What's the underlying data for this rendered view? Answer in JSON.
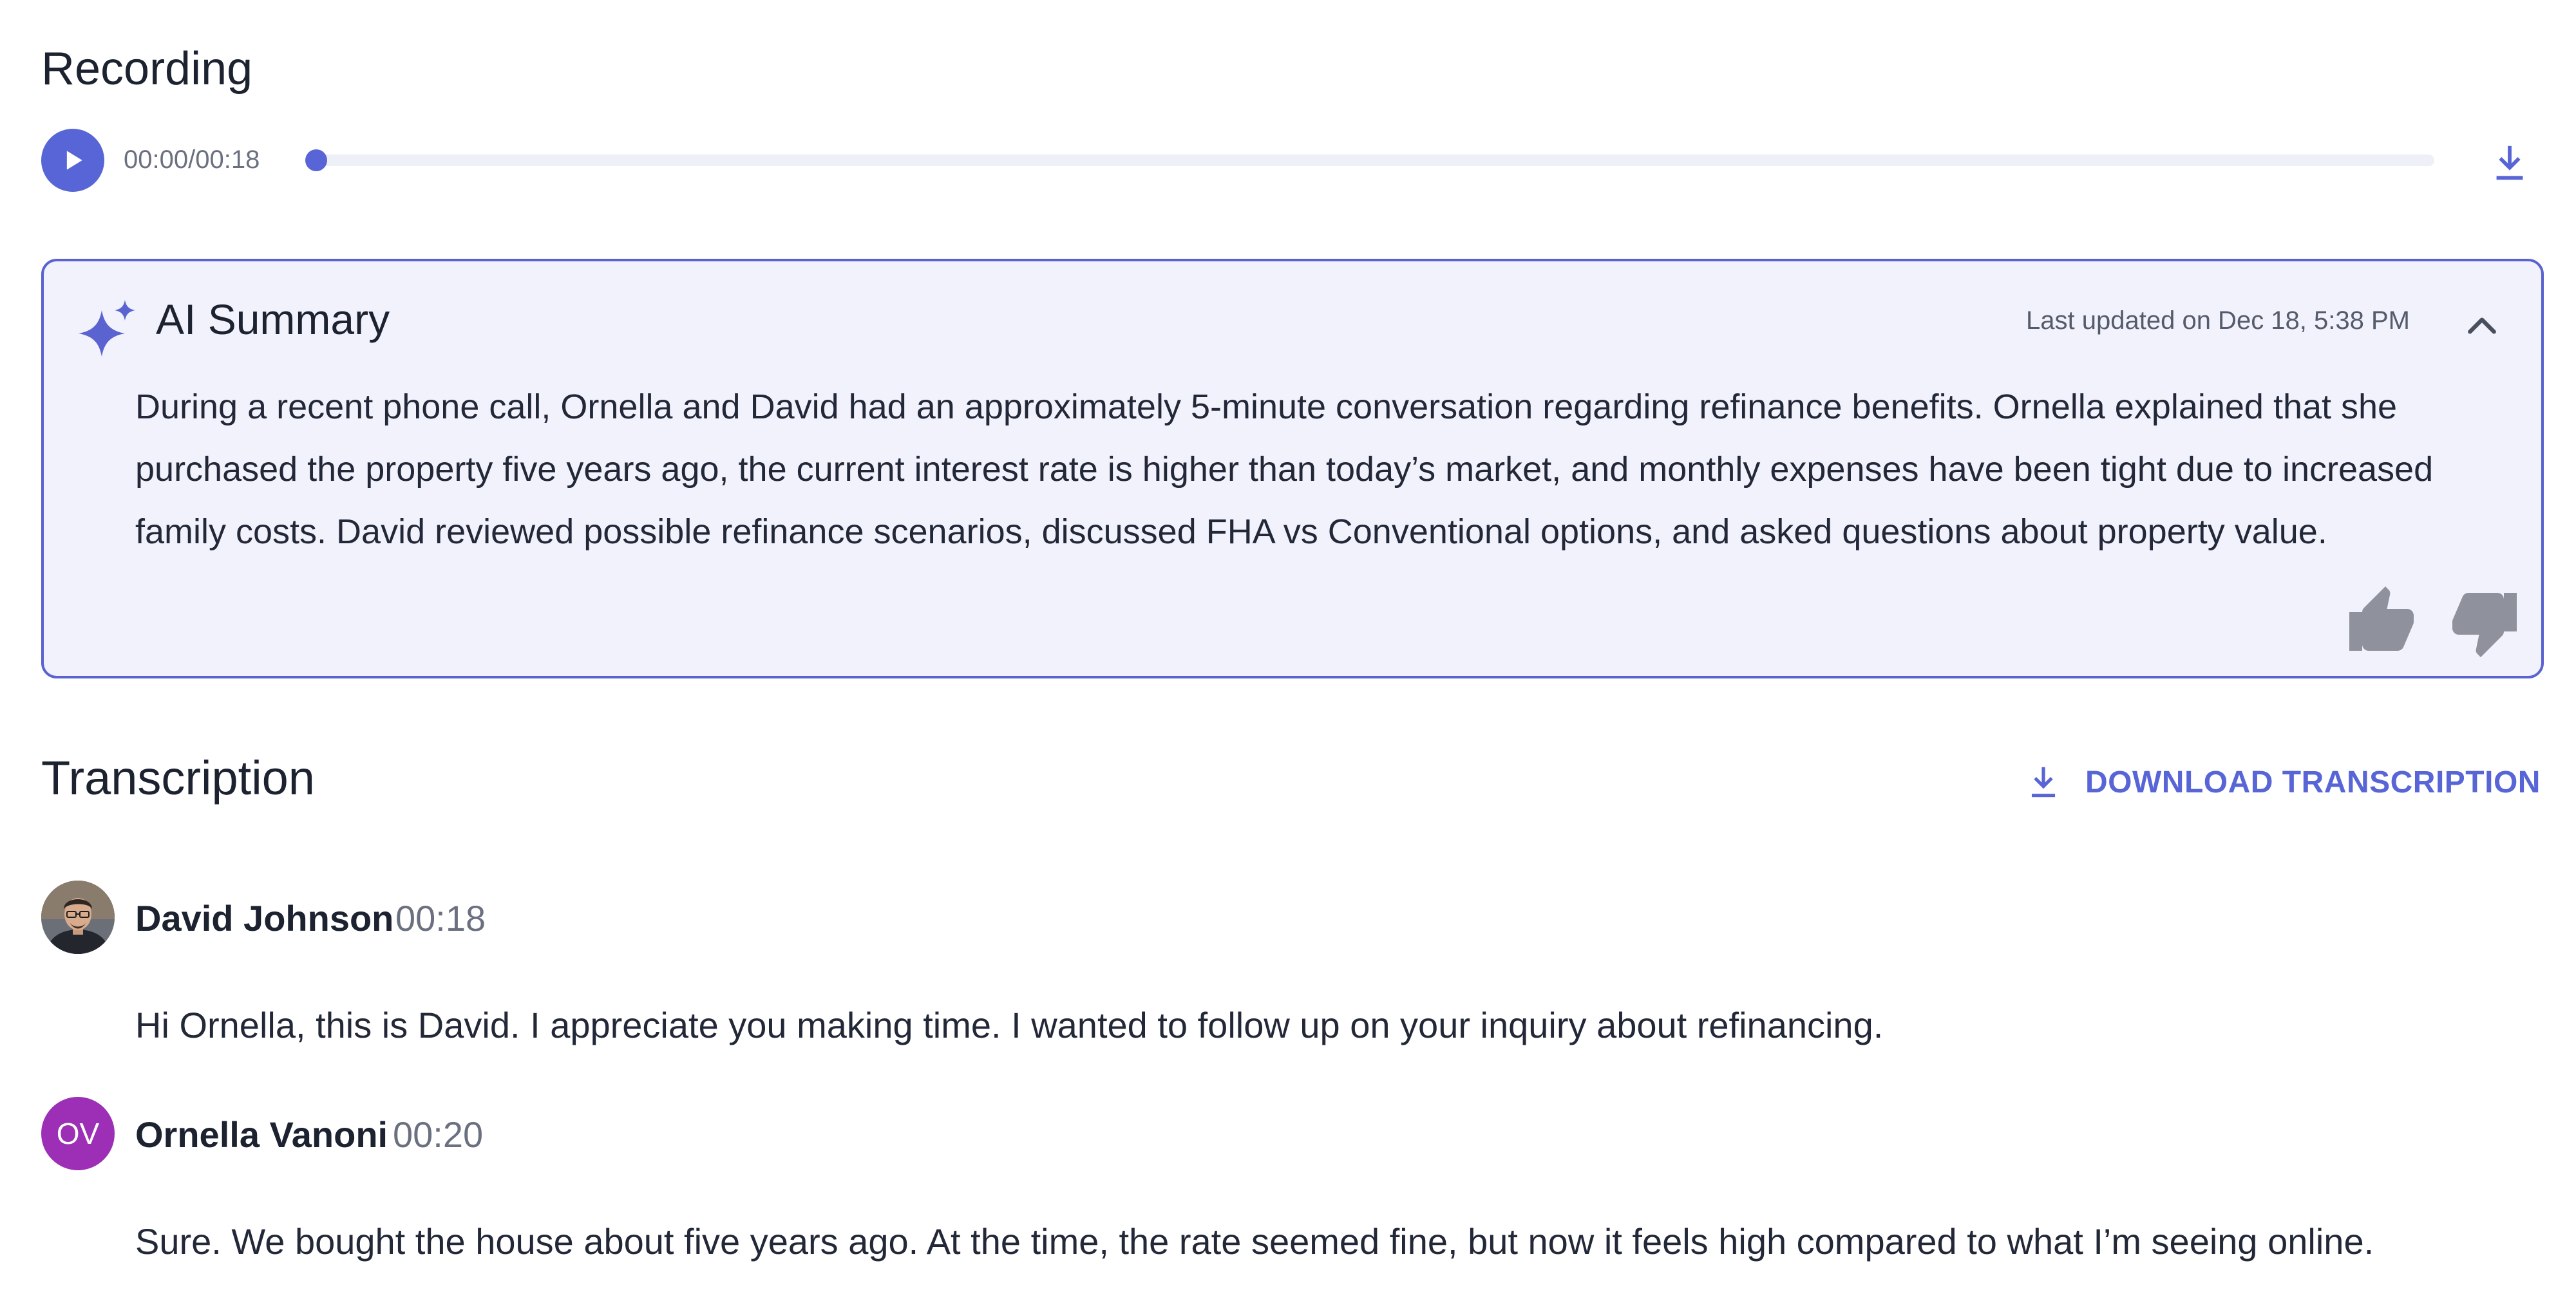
{
  "recording": {
    "title": "Recording",
    "time": "00:00/00:18",
    "progress": 0
  },
  "summary": {
    "title": "AI Summary",
    "updated": "Last updated on Dec 18, 5:38 PM",
    "text": "During a recent phone call, Ornella and David had an approximately 5-minute conversation regarding refinance benefits. Ornella explained that she purchased the property five years ago, the current interest rate is higher than today’s market, and monthly expenses have been tight due to increased family costs. David reviewed possible refinance scenarios, discussed FHA vs Conventional options, and asked questions about property value."
  },
  "transcription": {
    "title": "Transcription",
    "download_label": "DOWNLOAD TRANSCRIPTION",
    "entries": [
      {
        "speaker": "David Johnson",
        "time": "00:18",
        "text": "Hi Ornella, this is David. I appreciate you making time. I wanted to follow up on your inquiry about refinancing."
      },
      {
        "speaker": "Ornella Vanoni",
        "initials": "OV",
        "time": "00:20",
        "text": "Sure. We bought the house about five years ago. At the time, the rate seemed fine, but now it feels high compared to what I’m seeing online."
      }
    ]
  },
  "colors": {
    "accent": "#5865d6",
    "card_bg": "#f1f2fc",
    "card_border": "#5a63cf",
    "avatar_ov": "#9c2fb5",
    "muted_icon": "#8f929c"
  },
  "icons": {
    "play": "play-icon",
    "download": "download-icon",
    "sparkle": "sparkle-icon",
    "collapse": "chevron-up-icon",
    "thumb_up": "thumb-up-icon",
    "thumb_down": "thumb-down-icon"
  }
}
